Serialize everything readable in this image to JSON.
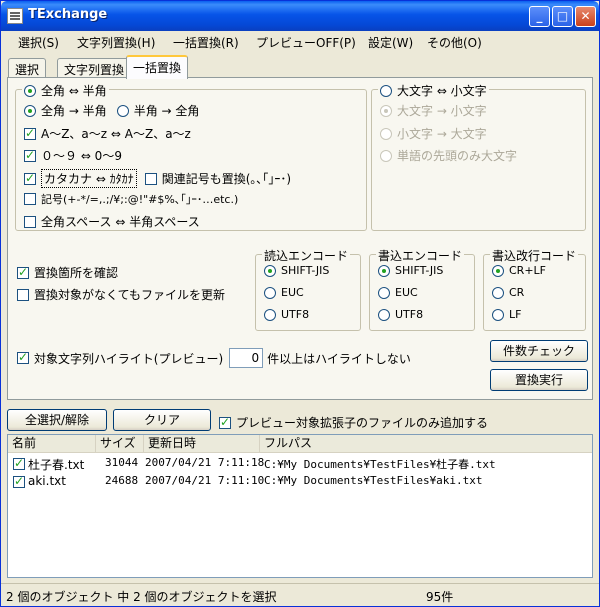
{
  "window": {
    "title": "TExchange"
  },
  "title_buttons": {
    "minimize": "_",
    "maximize": "□",
    "close": "✕"
  },
  "menu": [
    "選択(S)",
    "文字列置換(H)",
    "一括置換(R)",
    "プレビューOFF(P)",
    "設定(W)",
    "その他(O)"
  ],
  "tabs": [
    "選択",
    "文字列置換",
    "一括置換"
  ],
  "left_group": {
    "header_label": "全角 ⇔ 半角",
    "dir_fw_to_hw": "全角 → 半角",
    "dir_hw_to_fw": "半角 → 全角",
    "opt_alpha": "A～Z、a～z ⇔ A～Z、a～z",
    "opt_digits": "０～９ ⇔ 0～9",
    "opt_kana": "カタカナ ⇔ ｶﾀｶﾅ",
    "opt_related": "関連記号も置換(｡､｢｣ｰ･)",
    "opt_symbols": "記号(+-*/=,.;/¥;:@!\"#$%､｢｣ｰ･…etc.)",
    "opt_space": "全角スペース ⇔ 半角スペース"
  },
  "right_group": {
    "header_label": "大文字 ⇔ 小文字",
    "up_to_low": "大文字 → 小文字",
    "low_to_up": "小文字 → 大文字",
    "initial_cap": "単語の先頭のみ大文字"
  },
  "options": {
    "confirm": "置換箇所を確認",
    "update_all": "置換対象がなくてもファイルを更新",
    "highlight": "対象文字列ハイライト(プレビュー)",
    "highlight_count": "0",
    "highlight_suffix": "件以上はハイライトしない"
  },
  "read_encoding": {
    "title": "読込エンコード",
    "items": [
      "SHIFT-JIS",
      "EUC",
      "UTF8"
    ]
  },
  "write_encoding": {
    "title": "書込エンコード",
    "items": [
      "SHIFT-JIS",
      "EUC",
      "UTF8"
    ]
  },
  "newline": {
    "title": "書込改行コード",
    "items": [
      "CR+LF",
      "CR",
      "LF"
    ]
  },
  "buttons": {
    "count_check": "件数チェック",
    "execute": "置換実行",
    "select_all": "全選択/解除",
    "clear": "クリア"
  },
  "preview_ext_only": "プレビュー対象拡張子のファイルのみ追加する",
  "files": {
    "columns": [
      "名前",
      "サイズ",
      "更新日時",
      "フルパス"
    ],
    "rows": [
      {
        "name": "杜子春.txt",
        "size": "31044",
        "date": "2007/04/21 7:11:18",
        "path": "C:¥My Documents¥TestFiles¥杜子春.txt"
      },
      {
        "name": "aki.txt",
        "size": "24688",
        "date": "2007/04/21 7:11:10",
        "path": "C:¥My Documents¥TestFiles¥aki.txt"
      }
    ]
  },
  "status": {
    "selection": "2 個のオブジェクト 中 2 個のオブジェクトを選択",
    "count": "95件"
  },
  "colors": {
    "titlebar": "#0754e8",
    "window_bg": "#ece9d8",
    "check_green": "#21a121"
  }
}
